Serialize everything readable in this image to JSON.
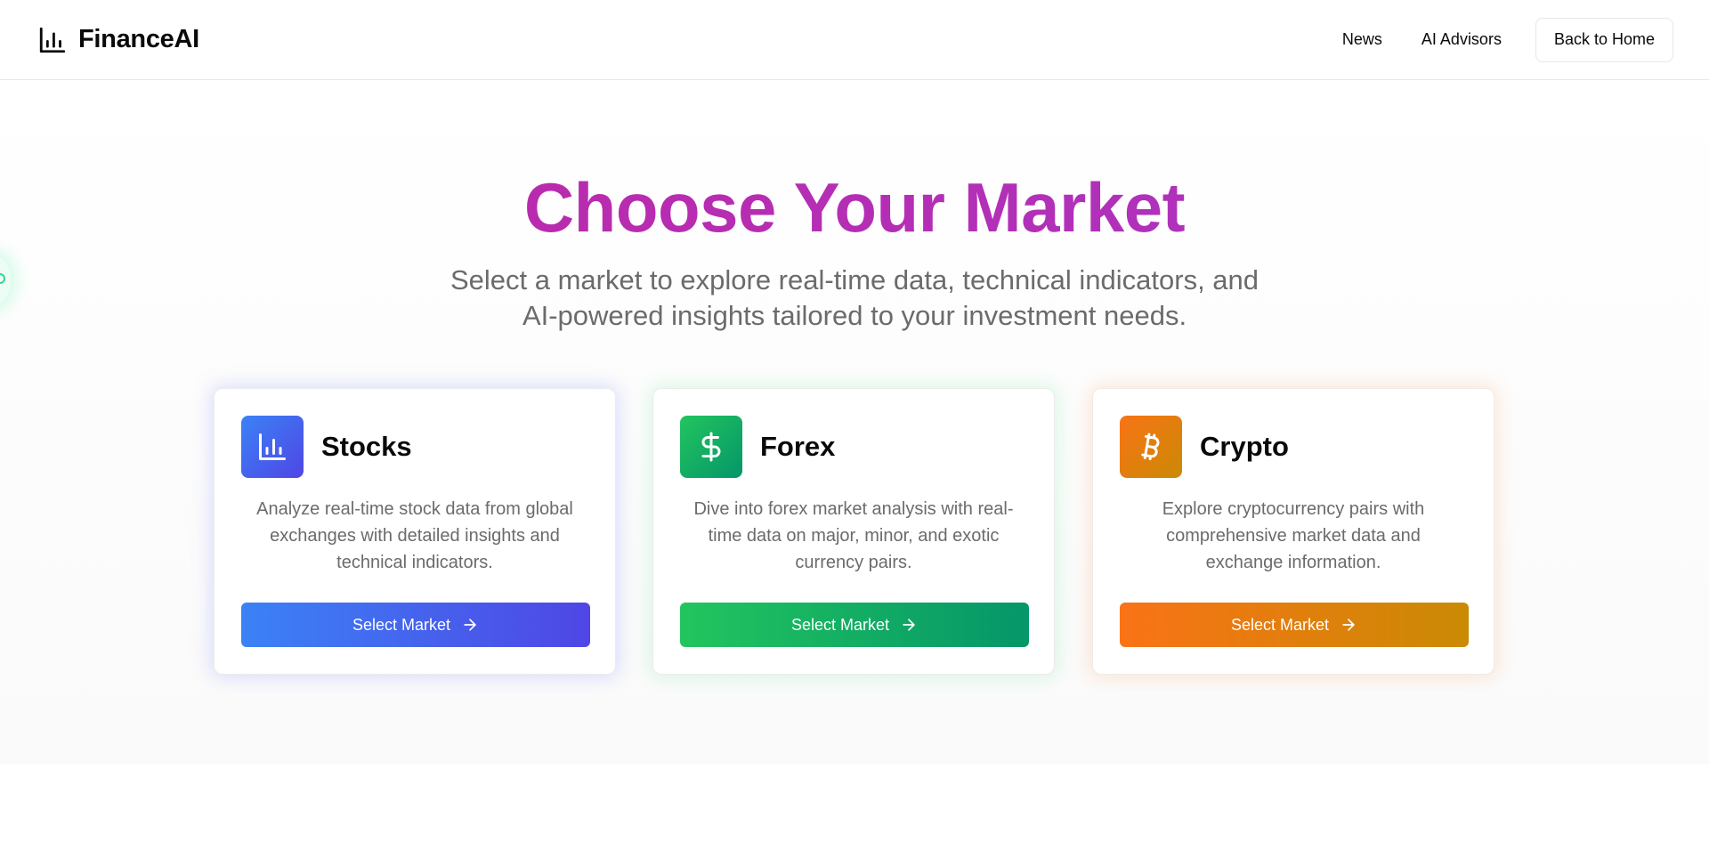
{
  "brand": {
    "name": "FinanceAI",
    "icon": "bar-chart-icon"
  },
  "nav": {
    "links": [
      "News",
      "AI Advisors"
    ],
    "back_label": "Back to Home"
  },
  "hero": {
    "title": "Choose Your Market",
    "subtitle_line1": "Select a market to explore real-time data, technical indicators, and",
    "subtitle_line2": "AI-powered insights tailored to your investment needs."
  },
  "markets": [
    {
      "name": "Stocks",
      "icon": "bar-chart-icon",
      "desc_line1": "Analyze real-time stock data from global",
      "desc_line2": "exchanges with detailed insights and",
      "desc_line3": "technical indicators.",
      "button_label": "Select Market",
      "color_from": "#3b82f6",
      "color_to": "#4f46e5"
    },
    {
      "name": "Forex",
      "icon": "dollar-icon",
      "desc_line1": "Dive into forex market analysis with real-",
      "desc_line2": "time data on major, minor, and exotic",
      "desc_line3": "currency pairs.",
      "button_label": "Select Market",
      "color_from": "#22c55e",
      "color_to": "#059669"
    },
    {
      "name": "Crypto",
      "icon": "bitcoin-icon",
      "desc_line1": "Explore cryptocurrency pairs with",
      "desc_line2": "comprehensive market data and",
      "desc_line3": "exchange information.",
      "button_label": "Select Market",
      "color_from": "#f97316",
      "color_to": "#ca8a04"
    }
  ]
}
